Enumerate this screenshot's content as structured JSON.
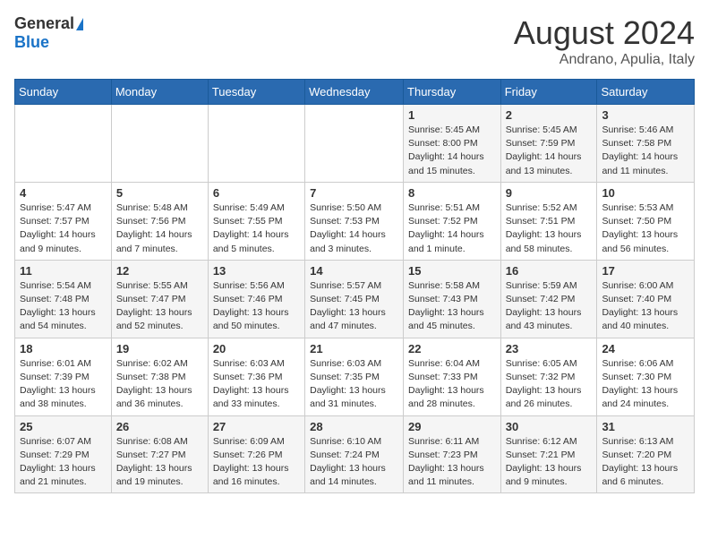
{
  "header": {
    "logo_general": "General",
    "logo_blue": "Blue",
    "month": "August 2024",
    "location": "Andrano, Apulia, Italy"
  },
  "days_of_week": [
    "Sunday",
    "Monday",
    "Tuesday",
    "Wednesday",
    "Thursday",
    "Friday",
    "Saturday"
  ],
  "weeks": [
    [
      {
        "day": "",
        "info": ""
      },
      {
        "day": "",
        "info": ""
      },
      {
        "day": "",
        "info": ""
      },
      {
        "day": "",
        "info": ""
      },
      {
        "day": "1",
        "info": "Sunrise: 5:45 AM\nSunset: 8:00 PM\nDaylight: 14 hours\nand 15 minutes."
      },
      {
        "day": "2",
        "info": "Sunrise: 5:45 AM\nSunset: 7:59 PM\nDaylight: 14 hours\nand 13 minutes."
      },
      {
        "day": "3",
        "info": "Sunrise: 5:46 AM\nSunset: 7:58 PM\nDaylight: 14 hours\nand 11 minutes."
      }
    ],
    [
      {
        "day": "4",
        "info": "Sunrise: 5:47 AM\nSunset: 7:57 PM\nDaylight: 14 hours\nand 9 minutes."
      },
      {
        "day": "5",
        "info": "Sunrise: 5:48 AM\nSunset: 7:56 PM\nDaylight: 14 hours\nand 7 minutes."
      },
      {
        "day": "6",
        "info": "Sunrise: 5:49 AM\nSunset: 7:55 PM\nDaylight: 14 hours\nand 5 minutes."
      },
      {
        "day": "7",
        "info": "Sunrise: 5:50 AM\nSunset: 7:53 PM\nDaylight: 14 hours\nand 3 minutes."
      },
      {
        "day": "8",
        "info": "Sunrise: 5:51 AM\nSunset: 7:52 PM\nDaylight: 14 hours\nand 1 minute."
      },
      {
        "day": "9",
        "info": "Sunrise: 5:52 AM\nSunset: 7:51 PM\nDaylight: 13 hours\nand 58 minutes."
      },
      {
        "day": "10",
        "info": "Sunrise: 5:53 AM\nSunset: 7:50 PM\nDaylight: 13 hours\nand 56 minutes."
      }
    ],
    [
      {
        "day": "11",
        "info": "Sunrise: 5:54 AM\nSunset: 7:48 PM\nDaylight: 13 hours\nand 54 minutes."
      },
      {
        "day": "12",
        "info": "Sunrise: 5:55 AM\nSunset: 7:47 PM\nDaylight: 13 hours\nand 52 minutes."
      },
      {
        "day": "13",
        "info": "Sunrise: 5:56 AM\nSunset: 7:46 PM\nDaylight: 13 hours\nand 50 minutes."
      },
      {
        "day": "14",
        "info": "Sunrise: 5:57 AM\nSunset: 7:45 PM\nDaylight: 13 hours\nand 47 minutes."
      },
      {
        "day": "15",
        "info": "Sunrise: 5:58 AM\nSunset: 7:43 PM\nDaylight: 13 hours\nand 45 minutes."
      },
      {
        "day": "16",
        "info": "Sunrise: 5:59 AM\nSunset: 7:42 PM\nDaylight: 13 hours\nand 43 minutes."
      },
      {
        "day": "17",
        "info": "Sunrise: 6:00 AM\nSunset: 7:40 PM\nDaylight: 13 hours\nand 40 minutes."
      }
    ],
    [
      {
        "day": "18",
        "info": "Sunrise: 6:01 AM\nSunset: 7:39 PM\nDaylight: 13 hours\nand 38 minutes."
      },
      {
        "day": "19",
        "info": "Sunrise: 6:02 AM\nSunset: 7:38 PM\nDaylight: 13 hours\nand 36 minutes."
      },
      {
        "day": "20",
        "info": "Sunrise: 6:03 AM\nSunset: 7:36 PM\nDaylight: 13 hours\nand 33 minutes."
      },
      {
        "day": "21",
        "info": "Sunrise: 6:03 AM\nSunset: 7:35 PM\nDaylight: 13 hours\nand 31 minutes."
      },
      {
        "day": "22",
        "info": "Sunrise: 6:04 AM\nSunset: 7:33 PM\nDaylight: 13 hours\nand 28 minutes."
      },
      {
        "day": "23",
        "info": "Sunrise: 6:05 AM\nSunset: 7:32 PM\nDaylight: 13 hours\nand 26 minutes."
      },
      {
        "day": "24",
        "info": "Sunrise: 6:06 AM\nSunset: 7:30 PM\nDaylight: 13 hours\nand 24 minutes."
      }
    ],
    [
      {
        "day": "25",
        "info": "Sunrise: 6:07 AM\nSunset: 7:29 PM\nDaylight: 13 hours\nand 21 minutes."
      },
      {
        "day": "26",
        "info": "Sunrise: 6:08 AM\nSunset: 7:27 PM\nDaylight: 13 hours\nand 19 minutes."
      },
      {
        "day": "27",
        "info": "Sunrise: 6:09 AM\nSunset: 7:26 PM\nDaylight: 13 hours\nand 16 minutes."
      },
      {
        "day": "28",
        "info": "Sunrise: 6:10 AM\nSunset: 7:24 PM\nDaylight: 13 hours\nand 14 minutes."
      },
      {
        "day": "29",
        "info": "Sunrise: 6:11 AM\nSunset: 7:23 PM\nDaylight: 13 hours\nand 11 minutes."
      },
      {
        "day": "30",
        "info": "Sunrise: 6:12 AM\nSunset: 7:21 PM\nDaylight: 13 hours\nand 9 minutes."
      },
      {
        "day": "31",
        "info": "Sunrise: 6:13 AM\nSunset: 7:20 PM\nDaylight: 13 hours\nand 6 minutes."
      }
    ]
  ]
}
